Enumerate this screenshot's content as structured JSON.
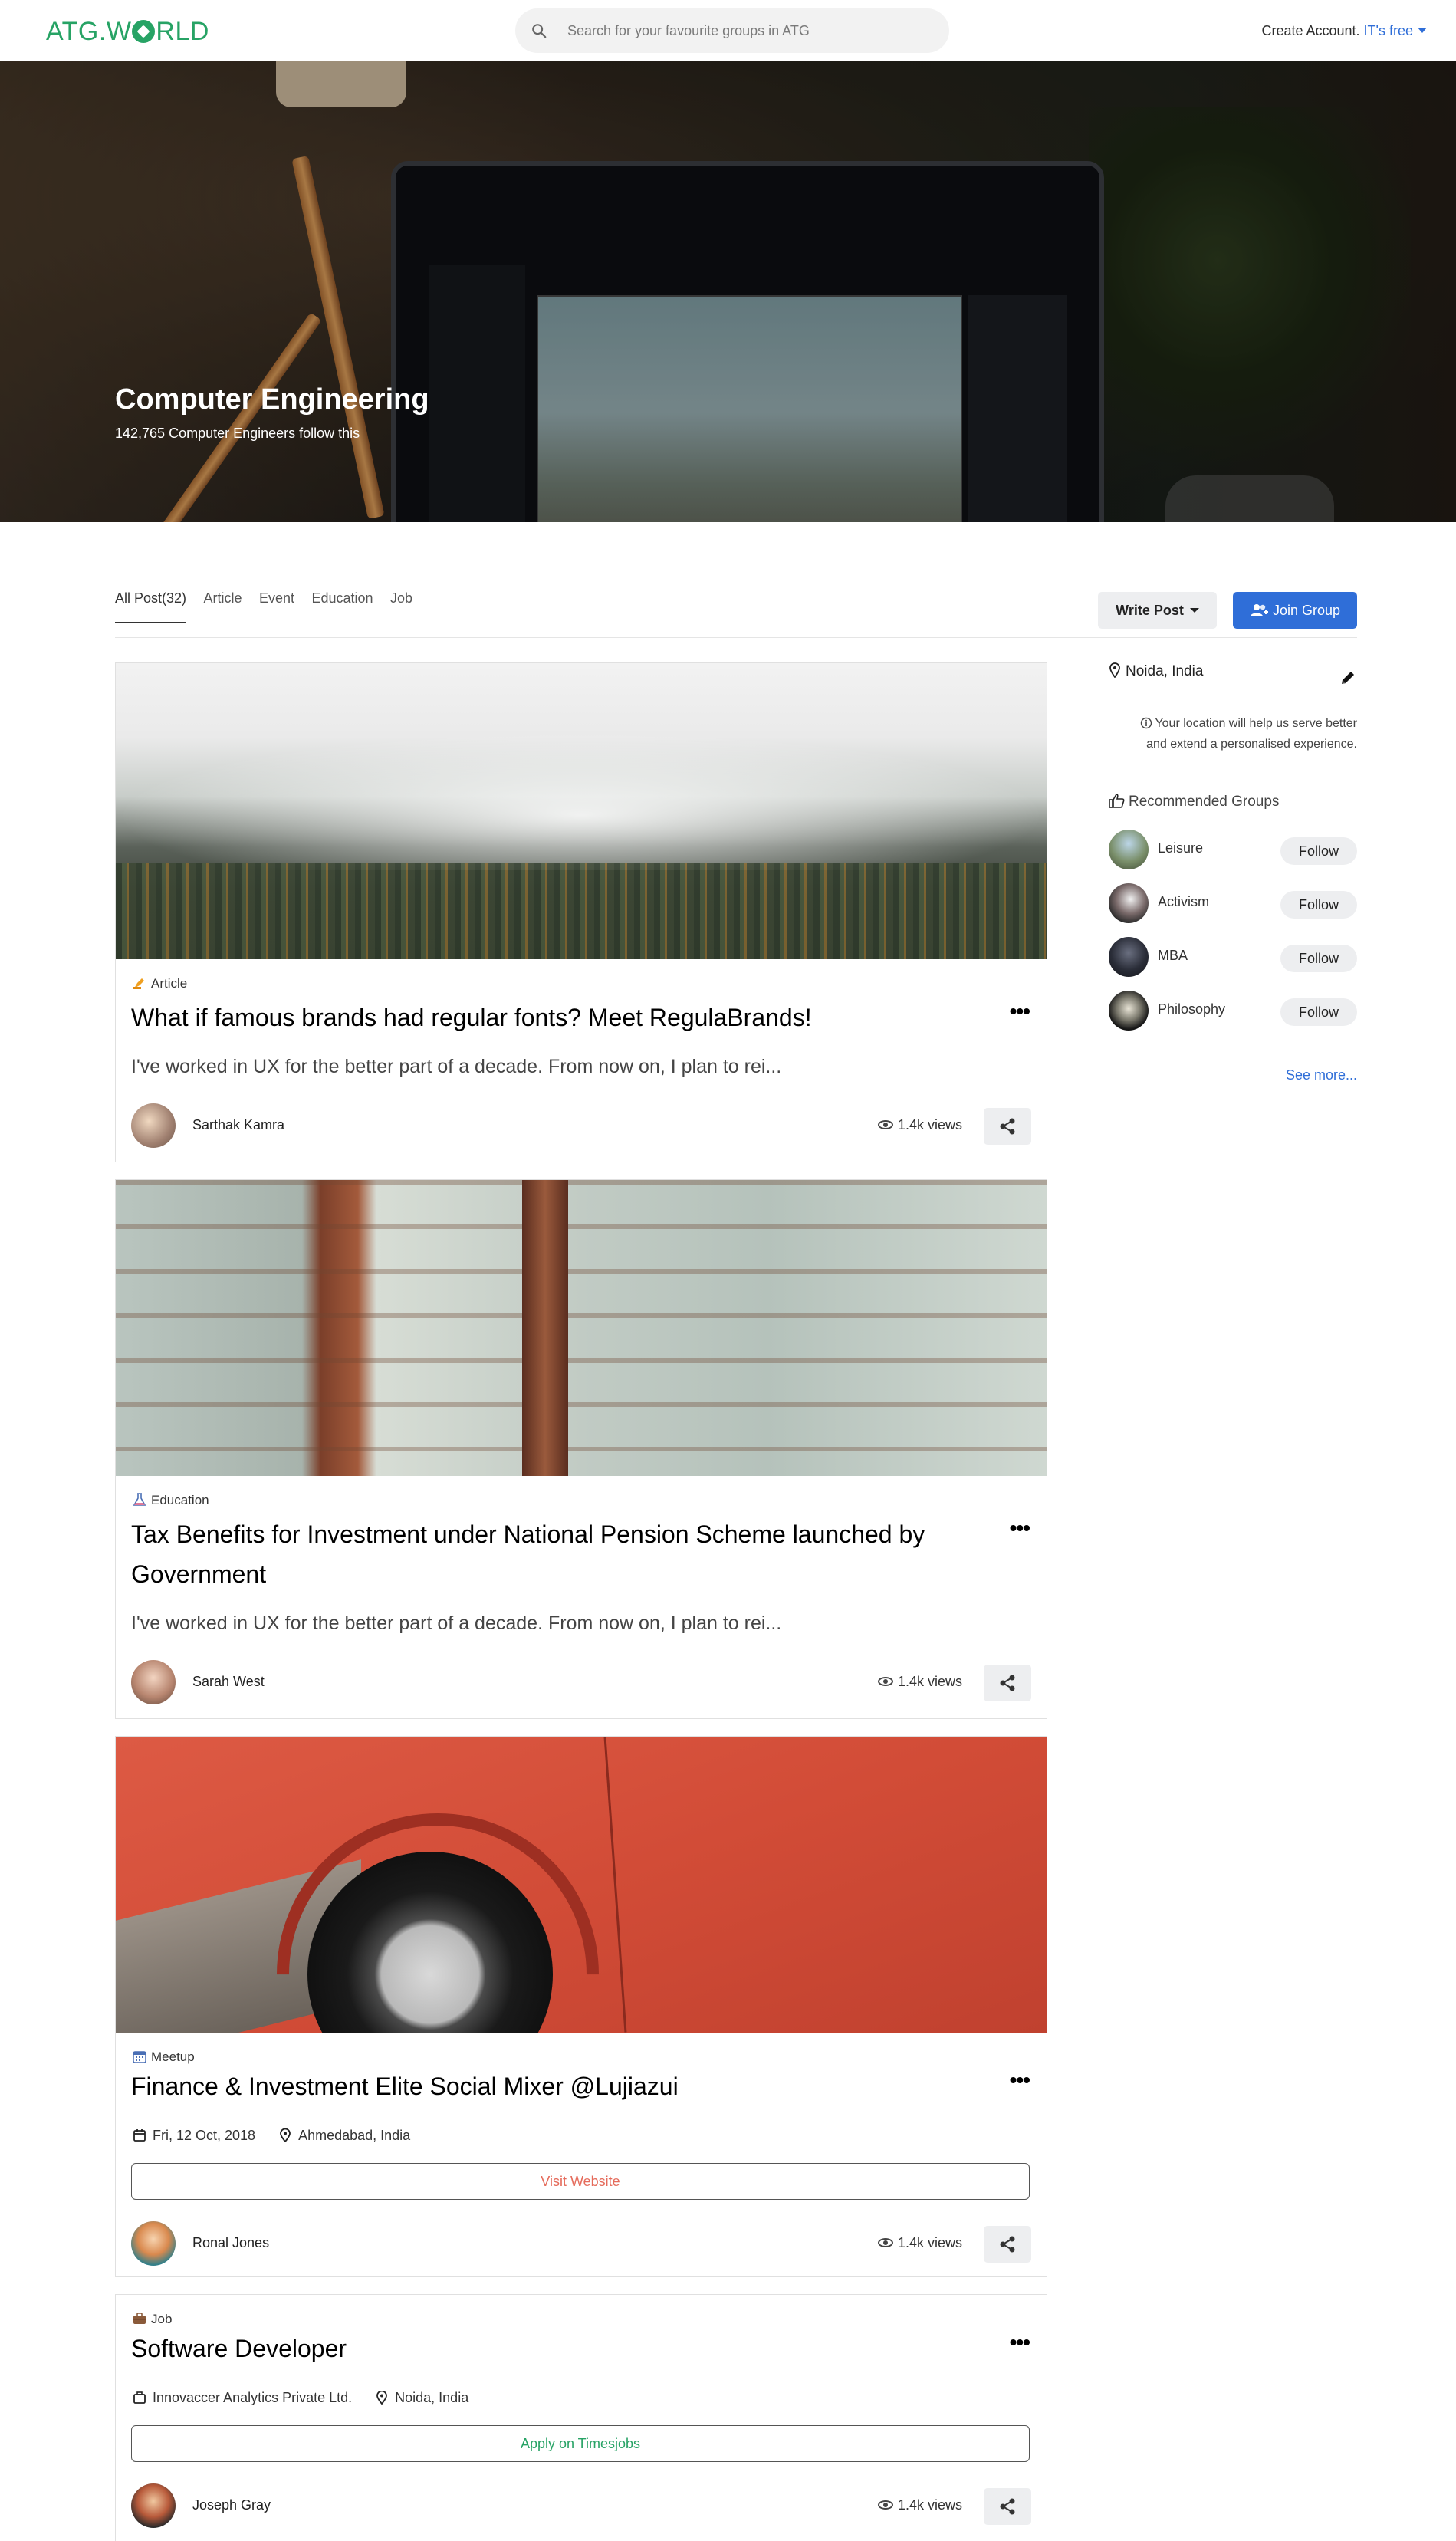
{
  "header": {
    "logo_prefix": "ATG.W",
    "logo_suffix": "RLD",
    "search_placeholder": "Search for your favourite groups in ATG",
    "account_label": "Create Account.",
    "account_free": "IT's free"
  },
  "hero": {
    "title": "Computer Engineering",
    "followers": "142,765 Computer Engineers follow this"
  },
  "tabs": [
    {
      "label": "All Post(32)",
      "active": true
    },
    {
      "label": "Article"
    },
    {
      "label": "Event"
    },
    {
      "label": "Education"
    },
    {
      "label": "Job"
    }
  ],
  "actions": {
    "write_post": "Write Post",
    "join_group": "Join Group"
  },
  "posts": [
    {
      "category": "Article",
      "category_icon": "pencil-hand-icon",
      "title": "What if famous brands had regular fonts? Meet RegulaBrands!",
      "excerpt": "I've worked in UX for the better part of a decade. From now on, I plan to rei...",
      "author": "Sarthak Kamra",
      "views": "1.4k views"
    },
    {
      "category": "Education",
      "category_icon": "flask-icon",
      "title": "Tax Benefits for Investment under National Pension Scheme launched by Government",
      "excerpt": "I've worked in UX for the better part of a decade. From now on, I plan to rei...",
      "author": "Sarah West",
      "views": "1.4k views"
    },
    {
      "category": "Meetup",
      "category_icon": "calendar-icon",
      "title": "Finance & Investment Elite Social Mixer @Lujiazui",
      "date": "Fri, 12 Oct, 2018",
      "location": "Ahmedabad, India",
      "button": "Visit Website",
      "author": "Ronal Jones",
      "views": "1.4k views"
    },
    {
      "category": "Job",
      "category_icon": "briefcase-icon",
      "title": "Software Developer",
      "company": "Innovaccer Analytics Private Ltd.",
      "location": "Noida, India",
      "button": "Apply on Timesjobs",
      "author": "Joseph Gray",
      "views": "1.4k views"
    }
  ],
  "sidebar": {
    "location": "Noida, India",
    "location_note_1": "Your location will help us serve better",
    "location_note_2": "and extend a personalised experience.",
    "recommended_title": "Recommended Groups",
    "groups": [
      {
        "name": "Leisure",
        "action": "Follow"
      },
      {
        "name": "Activism",
        "action": "Follow"
      },
      {
        "name": "MBA",
        "action": "Follow"
      },
      {
        "name": "Philosophy",
        "action": "Follow"
      }
    ],
    "see_more": "See more..."
  },
  "colors": {
    "brand_green": "#27a365",
    "primary_blue": "#2f6ed8",
    "visit_red": "#e56b5b"
  }
}
